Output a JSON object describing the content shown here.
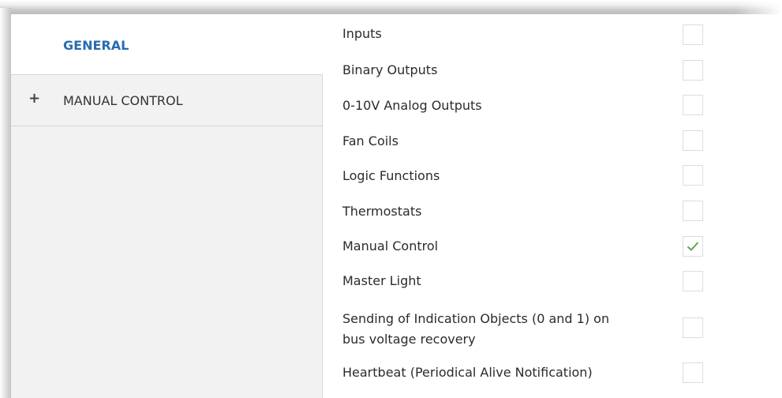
{
  "sidebar": {
    "items": [
      {
        "label": "GENERAL",
        "selected": true
      },
      {
        "label": "MANUAL CONTROL",
        "expand_icon": "+"
      }
    ]
  },
  "options": [
    {
      "label": "Inputs",
      "checked": false
    },
    {
      "label": "Binary Outputs",
      "checked": false
    },
    {
      "label": "0-10V Analog Outputs",
      "checked": false
    },
    {
      "label": "Fan Coils",
      "checked": false
    },
    {
      "label": "Logic Functions",
      "checked": false
    },
    {
      "label": "Thermostats",
      "checked": false
    },
    {
      "label": "Manual Control",
      "checked": true
    },
    {
      "label": "Master Light",
      "checked": false
    },
    {
      "label_line1": "Sending of Indication Objects (0 and 1) on",
      "label_line2": "bus voltage recovery",
      "checked": false
    },
    {
      "label": "Heartbeat (Periodical Alive Notification)",
      "checked": false
    }
  ],
  "colors": {
    "selected_text": "#2a6bb0",
    "check_mark": "#5aa84a"
  }
}
